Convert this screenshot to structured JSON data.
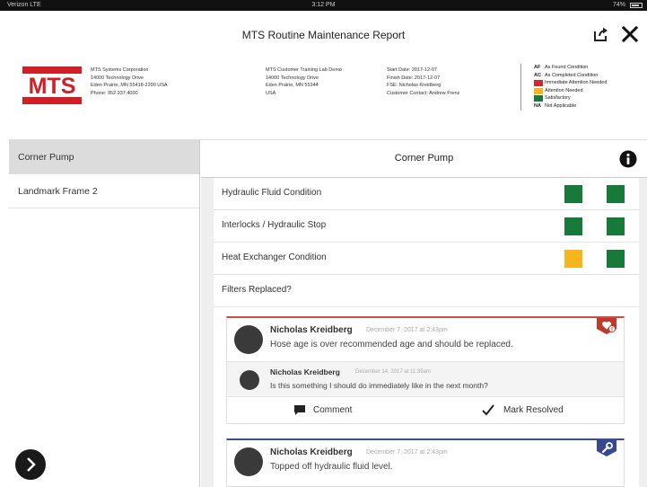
{
  "status_bar": {
    "left": "Verizon LTE",
    "time": "3:12 PM",
    "right": "74%"
  },
  "report": {
    "title": "MTS Routine Maintenance Report"
  },
  "company": {
    "logo_text": "MTS",
    "lines": [
      "MTS Systems Corporation",
      "14000 Technology Drive",
      "Eden Prairie, MN 55418-2290 USA",
      "Phone: 952.937.4000"
    ]
  },
  "customer": {
    "lines": [
      "MTS Customer Training Lab Demo",
      "14000 Technology Drive",
      "Eden Prairie, MN 55344",
      "USA"
    ]
  },
  "visit": {
    "lines": [
      "Start Date: 2017-12-07",
      "Finish Date: 2017-12-07",
      "FSE: Nicholas Kreidberg",
      "Customer Contact: Andrew Frenz"
    ]
  },
  "legend": {
    "items": [
      {
        "code": "AF",
        "label": "As Found Condition",
        "color": ""
      },
      {
        "code": "AC",
        "label": "As Completed Condition",
        "color": ""
      },
      {
        "code": "",
        "label": "Immediate Attention Needed",
        "color": "#d7262b"
      },
      {
        "code": "",
        "label": "Attention Needed",
        "color": "#f6b51c"
      },
      {
        "code": "",
        "label": "Satisfactory",
        "color": "#177a3a"
      },
      {
        "code": "NA",
        "label": "Not Applicable",
        "color": ""
      }
    ]
  },
  "sidebar": {
    "items": [
      {
        "label": "Corner Pump",
        "active": true
      },
      {
        "label": "Landmark Frame 2",
        "active": false
      }
    ]
  },
  "main": {
    "title": "Corner Pump"
  },
  "conditions": [
    {
      "label": "Hydraulic Fluid Condition",
      "as_found": "#177a3a",
      "as_completed": "#177a3a"
    },
    {
      "label": "Interlocks / Hydraulic Stop",
      "as_found": "#177a3a",
      "as_completed": "#177a3a"
    },
    {
      "label": "Heat Exchanger Condition",
      "as_found": "#f6b51c",
      "as_completed": "#177a3a"
    },
    {
      "label": "Filters Replaced?"
    }
  ],
  "comments": [
    {
      "author": "Nicholas Kreidberg",
      "date": "December 7, 2017 at 2:43pm",
      "text": "Hose age is over recommended age and should be replaced.",
      "accent": "#d04b44",
      "reply": {
        "author": "Nicholas Kreidberg",
        "date": "December 14, 2017 at 11:39am",
        "text": "Is this something I should do immediately like in the next month?"
      },
      "actions": {
        "comment": "Comment",
        "resolve": "Mark Resolved"
      }
    },
    {
      "author": "Nicholas Kreidberg",
      "date": "December 7, 2017 at 2:43pm",
      "text": "Topped off hydraulic fluid level.",
      "accent": "#3a4f92"
    }
  ],
  "icons": {
    "share": "share-icon",
    "close": "close-icon",
    "info": "info-icon",
    "next": "chevron-right-icon",
    "comment": "comment-icon",
    "resolve": "checkmark-icon",
    "urgent_badge": "alert-badge-icon",
    "wrench_badge": "wrench-badge-icon"
  }
}
